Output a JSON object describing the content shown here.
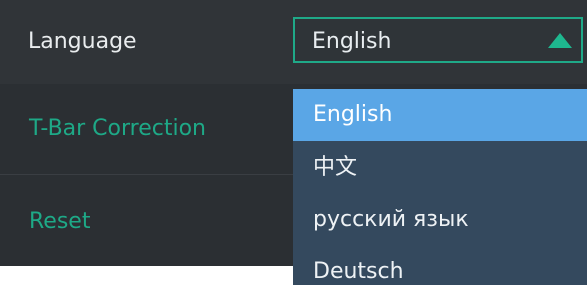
{
  "settings": {
    "language_label": "Language",
    "language_value": "English",
    "tbar_label": "T-Bar Correction",
    "reset_label": "Reset"
  },
  "dropdown": {
    "selected": "English",
    "options": [
      "English",
      "中文",
      "русский язык",
      "Deutsch"
    ]
  },
  "colors": {
    "accent": "#1ea987",
    "panel_bg": "#2f3237",
    "dropdown_bg": "#34495e",
    "selected_option_bg": "#5aa6e6"
  },
  "icons": {
    "select_arrow": "triangle-up-icon"
  }
}
